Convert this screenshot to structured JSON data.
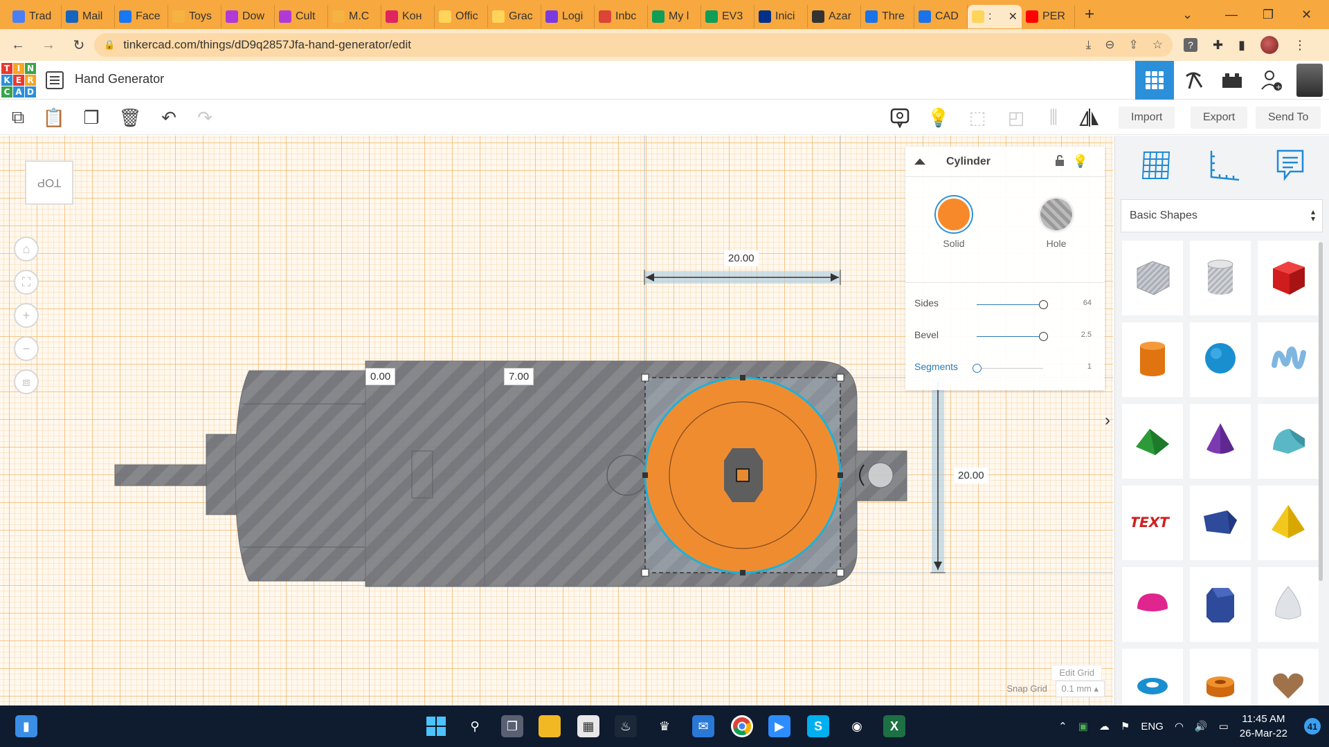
{
  "browser": {
    "tabs": [
      {
        "label": "Trad",
        "color": "#4a7ef5"
      },
      {
        "label": "Mail",
        "color": "#1565c0"
      },
      {
        "label": "Face",
        "color": "#1877f2"
      },
      {
        "label": "Toys",
        "color": "#f5b342"
      },
      {
        "label": "Dow",
        "color": "#b03ad8"
      },
      {
        "label": "Cult",
        "color": "#b03ad8"
      },
      {
        "label": "M.C",
        "color": "#f5b342"
      },
      {
        "label": "Koн",
        "color": "#e0245e"
      },
      {
        "label": "Offic",
        "color": "#ffd45a"
      },
      {
        "label": "Grac",
        "color": "#ffd45a"
      },
      {
        "label": "Logi",
        "color": "#7a3ae0"
      },
      {
        "label": "Inbc",
        "color": "#db4437"
      },
      {
        "label": "My l",
        "color": "#0f9d58"
      },
      {
        "label": "EV3",
        "color": "#0f9d58"
      },
      {
        "label": "Inici",
        "color": "#003087"
      },
      {
        "label": "Azar",
        "color": "#333333"
      },
      {
        "label": "Thre",
        "color": "#1a73e8"
      },
      {
        "label": "CAD",
        "color": "#1a73e8"
      },
      {
        "label": ":",
        "color": "#ffd45a"
      },
      {
        "label": "PER",
        "color": "#ff0000"
      }
    ],
    "active_tab": 18,
    "url": "tinkercad.com/things/dD9q2857Jfa-hand-generator/edit"
  },
  "app": {
    "title": "Hand Generator",
    "logo_letters": [
      "T",
      "I",
      "N",
      "K",
      "E",
      "R",
      "C",
      "A",
      "D"
    ],
    "logo_colors": [
      "#e83a2f",
      "#f5a623",
      "#3aa44a",
      "#2c8fd9",
      "#e83a2f",
      "#f5a623",
      "#3aa44a",
      "#2c8fd9",
      "#2c8fd9"
    ]
  },
  "toolbar": {
    "import_label": "Import",
    "export_label": "Export",
    "sendto_label": "Send To"
  },
  "workplane": {
    "viewcube_label": "TOP",
    "dim_x": "0.00",
    "dim_y": "7.00",
    "width_label": "20.00",
    "length_label": "20.00",
    "edit_grid_label": "Edit Grid",
    "snap_grid_label": "Snap Grid",
    "snap_grid_value": "0.1 mm"
  },
  "inspector": {
    "title": "Cylinder",
    "solid_label": "Solid",
    "hole_label": "Hole",
    "solid_color": "#f7892a",
    "props": [
      {
        "label": "Sides",
        "value": "64",
        "fraction": 1.0
      },
      {
        "label": "Bevel",
        "value": "2.5",
        "fraction": 1.0
      },
      {
        "label": "Segments",
        "value": "1",
        "fraction": 0.0
      }
    ]
  },
  "shapes_panel": {
    "category": "Basic Shapes",
    "shapes": [
      "box-hole-icon",
      "cylinder-hole-icon",
      "box-icon",
      "cylinder-icon",
      "sphere-icon",
      "scribble-icon",
      "roof-icon",
      "cone-icon",
      "round-roof-icon",
      "text-icon",
      "prism-icon",
      "pyramid-icon",
      "half-sphere-icon",
      "polygon-icon",
      "paraboloid-icon",
      "torus-icon",
      "tube-icon",
      "heart-icon"
    ]
  },
  "taskbar": {
    "lang": "ENG",
    "time": "11:45 AM",
    "date": "26-Mar-22",
    "notification_count": "41"
  }
}
